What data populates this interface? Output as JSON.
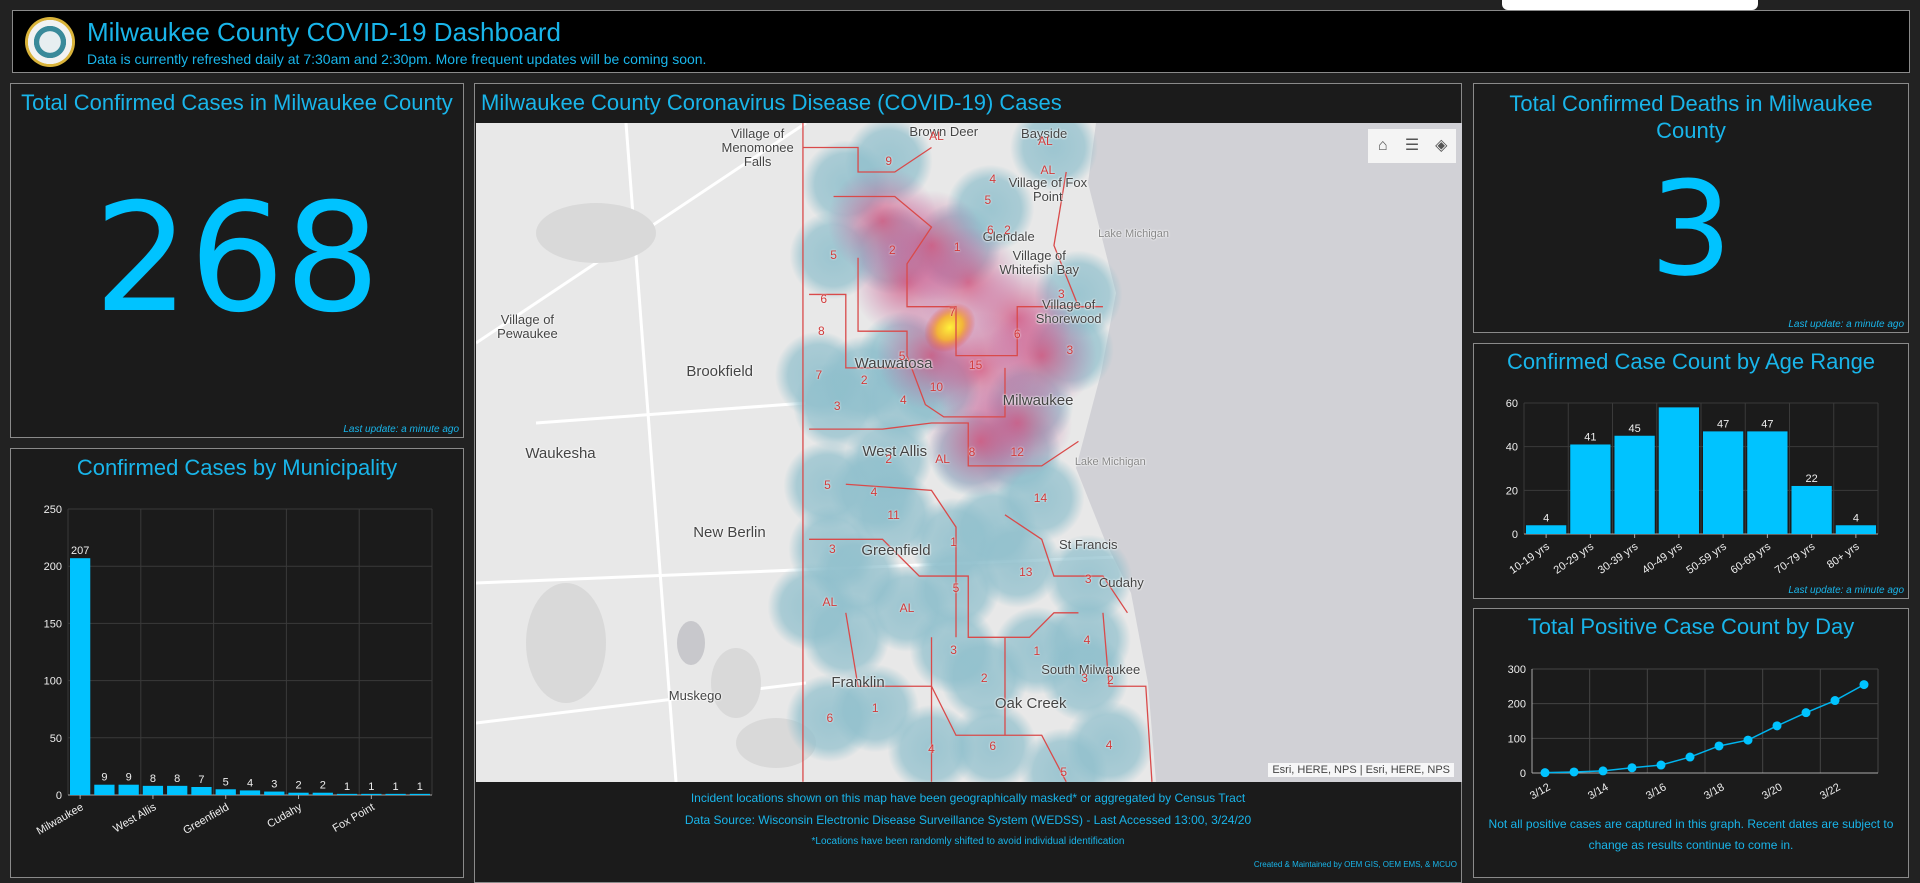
{
  "header": {
    "title": "Milwaukee County COVID-19 Dashboard",
    "subtitle": "Data is currently refreshed daily at 7:30am and 2:30pm. More frequent updates will be coming soon.",
    "logo_text": "MILWAUKEE COUNTY"
  },
  "total_cases": {
    "title": "Total Confirmed Cases in Milwaukee County",
    "value": "268",
    "update": "Last update: a minute ago"
  },
  "total_deaths": {
    "title": "Total Confirmed Deaths in Milwaukee County",
    "value": "3",
    "update": "Last update: a minute ago"
  },
  "map_panel": {
    "title": "Milwaukee County Coronavirus Disease (COVID-19) Cases",
    "tools": [
      "home-icon",
      "legend-icon",
      "layers-icon"
    ],
    "attribution": "Esri, HERE, NPS | Esri, HERE, NPS",
    "places": [
      "Village of Menomonee Falls",
      "Brown Deer",
      "Bayside",
      "Village of Fox Point",
      "Glendale",
      "Lake Michigan",
      "Village of Whitefish Bay",
      "Village of Shorewood",
      "Village of Pewaukee",
      "Brookfield",
      "Wauwatosa",
      "Milwaukee",
      "Waukesha",
      "West Allis",
      "Lake Michigan",
      "New Berlin",
      "St Francis",
      "Greenfield",
      "Cudahy",
      "South Milwaukee",
      "Muskego",
      "Franklin",
      "Oak Creek"
    ],
    "cluster_labels": [
      "9",
      "AL",
      "AL",
      "4",
      "5",
      "6",
      "2",
      "AL",
      "2",
      "1",
      "5",
      "7",
      "6",
      "3",
      "15",
      "10",
      "5",
      "4",
      "2",
      "7",
      "3",
      "8",
      "12",
      "14",
      "AL",
      "2",
      "4",
      "11",
      "5",
      "3",
      "13",
      "1",
      "3",
      "5",
      "AL",
      "AL",
      "4",
      "1",
      "3",
      "2",
      "1",
      "6",
      "4",
      "6",
      "4",
      "5",
      "3",
      "2",
      "8",
      "6",
      "3"
    ],
    "footer": [
      "Incident locations shown on this map have been geographically masked* or aggregated by Census Tract",
      "Data Source: Wisconsin Electronic Disease Surveillance System (WEDSS) - Last Accessed 13:00, 3/24/20",
      "*Locations have been randomly shifted to avoid individual identification"
    ],
    "credit": "Created & Maintained by OEM GIS, OEM EMS, & MCUO"
  },
  "colors": {
    "accent": "#00c3ff",
    "title": "#19b5ea",
    "panel": "#1b1b1b"
  },
  "chart_data": [
    {
      "type": "bar",
      "title": "Confirmed Cases by Municipality",
      "categories": [
        "Milwaukee",
        "",
        "",
        "West Allis",
        "",
        "",
        "Greenfield",
        "",
        "",
        "Cudahy",
        "",
        "",
        "Fox Point",
        "",
        ""
      ],
      "values": [
        207,
        9,
        9,
        8,
        8,
        7,
        5,
        4,
        3,
        2,
        2,
        1,
        1,
        1,
        1
      ],
      "ylim": [
        0,
        250
      ],
      "yticks": [
        0,
        50,
        100,
        150,
        200,
        250
      ],
      "grid": true
    },
    {
      "type": "bar",
      "title": "Confirmed Case Count by Age Range",
      "categories": [
        "10-19 yrs",
        "20-29 yrs",
        "30-39 yrs",
        "40-49 yrs",
        "50-59 yrs",
        "60-69 yrs",
        "70-79 yrs",
        "80+ yrs"
      ],
      "values": [
        4,
        41,
        45,
        58,
        47,
        47,
        22,
        4
      ],
      "data_labels": [
        "4",
        "41",
        "45",
        "",
        "47",
        "47",
        "22",
        "4"
      ],
      "ylim": [
        0,
        60
      ],
      "yticks": [
        0,
        20,
        40,
        60
      ],
      "grid": true,
      "update": "Last update: a minute ago"
    },
    {
      "type": "line",
      "title": "Total Positive Case Count by Day",
      "x": [
        "3/12",
        "3/13",
        "3/14",
        "3/15",
        "3/16",
        "3/17",
        "3/18",
        "3/19",
        "3/20",
        "3/21",
        "3/22",
        "3/23"
      ],
      "values": [
        1,
        3,
        6,
        15,
        23,
        46,
        78,
        95,
        136,
        174,
        209,
        255
      ],
      "xticks": [
        "3/12",
        "3/14",
        "3/16",
        "3/18",
        "3/20",
        "3/22"
      ],
      "ylim": [
        0,
        300
      ],
      "yticks": [
        0,
        100,
        200,
        300
      ],
      "grid": true,
      "note": "Not all positive cases are captured in this graph. Recent dates are subject to change as results continue to come in."
    }
  ]
}
